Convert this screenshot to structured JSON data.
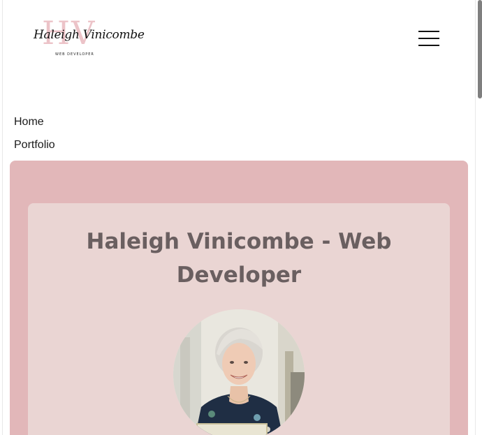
{
  "header": {
    "logo": {
      "monogram": "HV",
      "script": "Haleigh Vinicombe",
      "subtitle": "WEB DEVELOPER"
    },
    "menu_icon": "hamburger-menu-icon"
  },
  "nav": {
    "items": [
      {
        "label": "Home"
      },
      {
        "label": "Portfolio"
      }
    ]
  },
  "hero": {
    "title": "Haleigh Vinicombe - Web Developer",
    "photo_alt": "Haleigh Vinicombe"
  },
  "colors": {
    "hero_bg": "#e2b7b9",
    "card_bg": "#ead5d3",
    "title_text": "#6a5f60",
    "logo_monogram": "#ecc3c8"
  }
}
